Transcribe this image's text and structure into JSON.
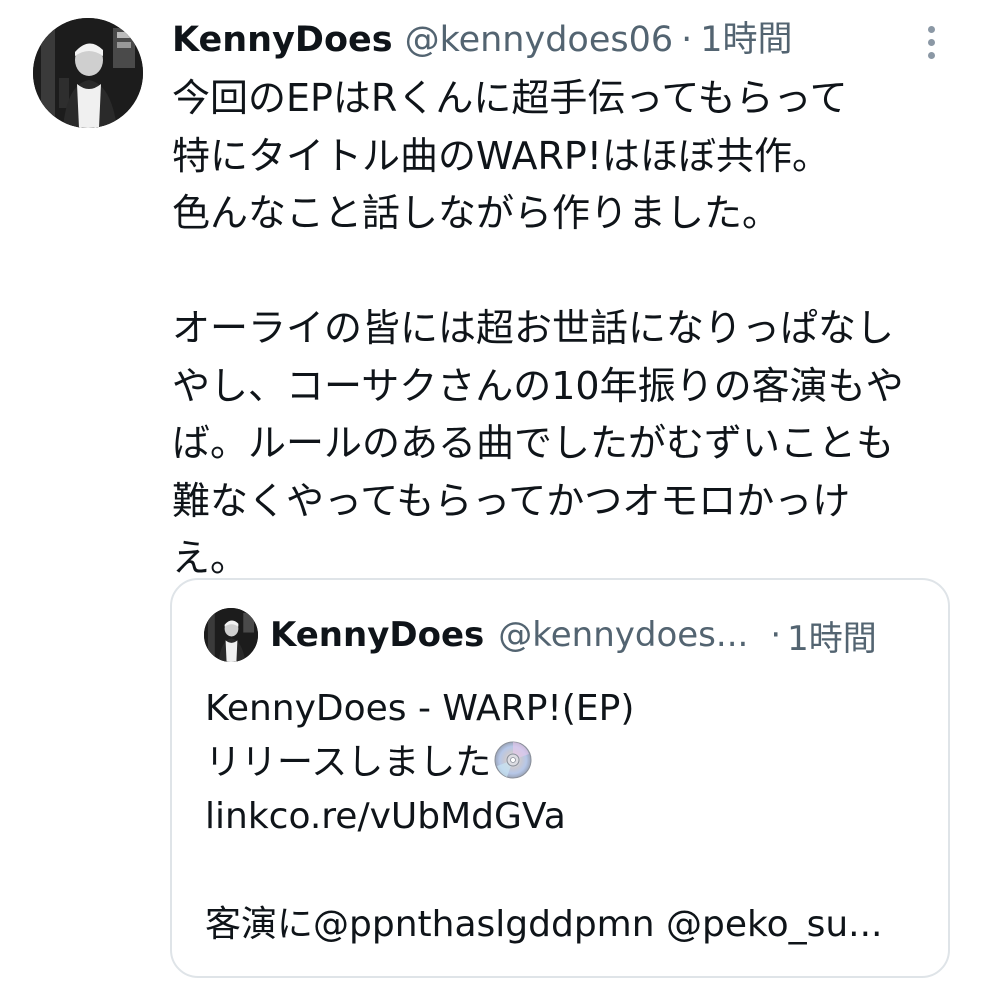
{
  "tweet": {
    "display_name": "KennyDoes",
    "handle": "@kennydoes06",
    "separator": "·",
    "time": "1時間",
    "lines": [
      "今回のEPはRくんに超手伝ってもらって",
      "特にタイトル曲のWARP!はほぼ共作。",
      "色んなこと話しながら作りました。",
      "",
      "オーライの皆には超お世話になりっぱなし",
      "やし、コーサクさんの10年振りの客演もや",
      "ば。ルールのある曲でしたがむずいことも",
      "難なくやってもらってかつオモロかっけ",
      "え。"
    ]
  },
  "quoted_tweet": {
    "display_name": "KennyDoes",
    "handle": "@kennydoes...",
    "separator": "·",
    "time": "1時間",
    "line1": "KennyDoes - WARP!(EP)",
    "line2": "リリースしました",
    "line2_icon": "optical-disc-icon",
    "link": "linkco.re/vUbMdGVa",
    "line4": "",
    "line5": "客演に@ppnthaslgddpmn @peko_su..."
  },
  "icons": {
    "more": "more-options-icon",
    "avatar": "avatar"
  },
  "colors": {
    "text": "#0f1419",
    "secondary": "#536471",
    "border": "#dfe4e8",
    "icon": "#8b98a5"
  }
}
